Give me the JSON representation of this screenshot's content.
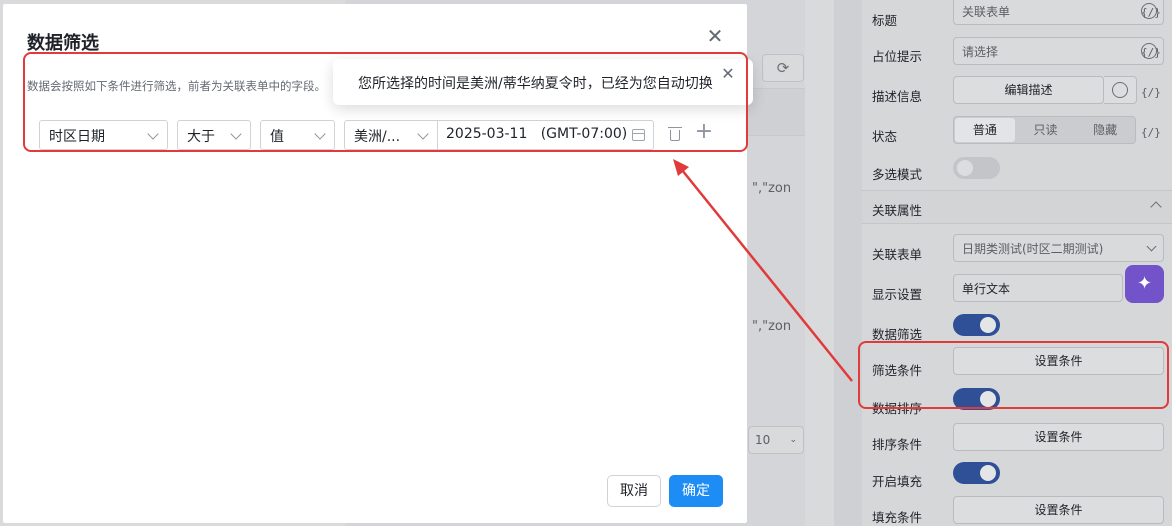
{
  "modal": {
    "title": "数据筛选",
    "close_icon": "close-icon",
    "description": "数据会按照如下条件进行筛选，前者为关联表单中的字段。",
    "filter": {
      "field": "时区日期",
      "operator": "大于",
      "value_type": "值",
      "timezone": "美洲/...",
      "date_value": "2025-03-11   (GMT-07:00)"
    },
    "cancel_label": "取消",
    "confirm_label": "确定"
  },
  "toast": {
    "message": "您所选择的时间是美洲/蒂华纳夏令时，已经为您自动切换"
  },
  "background": {
    "fragment_1": "\",\"zon",
    "fragment_2": "\",\"zon",
    "page_size": "10"
  },
  "panel": {
    "title_label": "标题",
    "title_value": "关联表单",
    "placeholder_label": "占位提示",
    "placeholder_value": "请选择",
    "desc_label": "描述信息",
    "desc_button": "编辑描述",
    "state_label": "状态",
    "state_options": [
      "普通",
      "只读",
      "隐藏"
    ],
    "multi_label": "多选模式",
    "multi_on": false,
    "section_title": "关联属性",
    "assoc_form_label": "关联表单",
    "assoc_form_value": "日期类测试(时区二期测试)",
    "display_label": "显示设置",
    "display_value": "单行文本",
    "filter_label": "数据筛选",
    "filter_on": true,
    "filter_cond_label": "筛选条件",
    "filter_cond_button": "设置条件",
    "sort_label": "数据排序",
    "sort_on": true,
    "sort_cond_label": "排序条件",
    "sort_cond_button": "设置条件",
    "fill_label": "开启填充",
    "fill_on": true,
    "fill_cond_label": "填充条件",
    "fill_cond_button": "设置条件",
    "fx_label": "{/}"
  },
  "colors": {
    "primary": "#1e8cf5",
    "toggle_on": "#2f4f96",
    "annotation": "#e03a3a"
  }
}
